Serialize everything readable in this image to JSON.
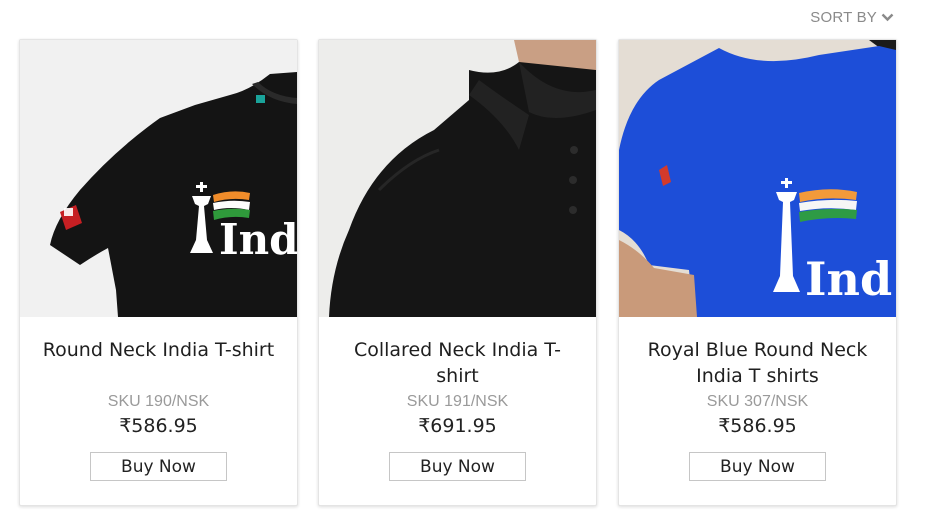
{
  "sort": {
    "label": "SORT BY",
    "icon": "chevron-down-icon"
  },
  "products": [
    {
      "title": "Round Neck India T-shirt",
      "sku": "SKU 190/NSK",
      "price": "₹586.95",
      "buy_label": "Buy Now",
      "shirt_color": "#141414",
      "print_text": "Indi"
    },
    {
      "title": "Collared Neck India T-shirt",
      "sku": "SKU 191/NSK",
      "price": "₹691.95",
      "buy_label": "Buy Now",
      "shirt_color": "#151515"
    },
    {
      "title": "Royal Blue Round Neck India T shirts",
      "sku": "SKU 307/NSK",
      "price": "₹586.95",
      "buy_label": "Buy Now",
      "shirt_color": "#1d4ed8",
      "print_text": "Ind"
    }
  ]
}
